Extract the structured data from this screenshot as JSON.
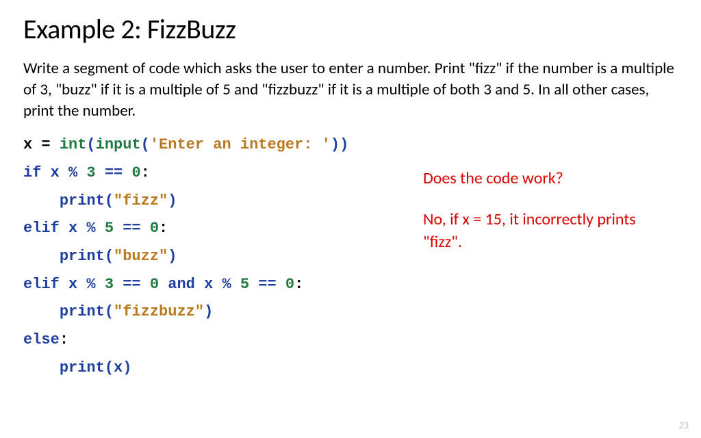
{
  "title": "Example 2: FizzBuzz",
  "prompt": "Write a segment of code which asks the user to enter a number. Print \"fizz\" if the number is a multiple of 3, \"buzz\" if it is a multiple of 5 and \"fizzbuzz\" if it is a multiple of both 3 and 5. In all other cases, print the number.",
  "code": {
    "l1": {
      "x": "x",
      "eq": " = ",
      "int_": "int",
      "p1": "(",
      "input_": "input",
      "p2": "(",
      "str": "'Enter an integer: '",
      "p3": "))"
    },
    "l2": {
      "if_": "if",
      "sp": " ",
      "x": "x",
      "op": " % ",
      "n": "3",
      "eq": " == ",
      "z": "0",
      "colon": ":"
    },
    "l3": {
      "indent": "    ",
      "print_": "print",
      "p1": "(",
      "str": "\"fizz\"",
      "p2": ")"
    },
    "l4": {
      "elif_": "elif",
      "sp": " ",
      "x": "x",
      "op": " % ",
      "n": "5",
      "eq": " == ",
      "z": "0",
      "colon": ":"
    },
    "l5": {
      "indent": "    ",
      "print_": "print",
      "p1": "(",
      "str": "\"buzz\"",
      "p2": ")"
    },
    "l6": {
      "elif_": "elif",
      "sp": " ",
      "x1": "x",
      "op1": " % ",
      "n1": "3",
      "eq1": " == ",
      "z1": "0",
      "and_": " and ",
      "x2": "x",
      "op2": " % ",
      "n2": "5",
      "eq2": " == ",
      "z2": "0",
      "colon": ":"
    },
    "l7": {
      "indent": "    ",
      "print_": "print",
      "p1": "(",
      "str": "\"fizzbuzz\"",
      "p2": ")"
    },
    "l8": {
      "else_": "else",
      "colon": ":"
    },
    "l9": {
      "indent": "    ",
      "print_": "print",
      "p1": "(",
      "x": "x",
      "p2": ")"
    }
  },
  "note1": "Does the code work?",
  "note2": "No, if x = 15, it incorrectly prints \"fizz\".",
  "page": "23"
}
